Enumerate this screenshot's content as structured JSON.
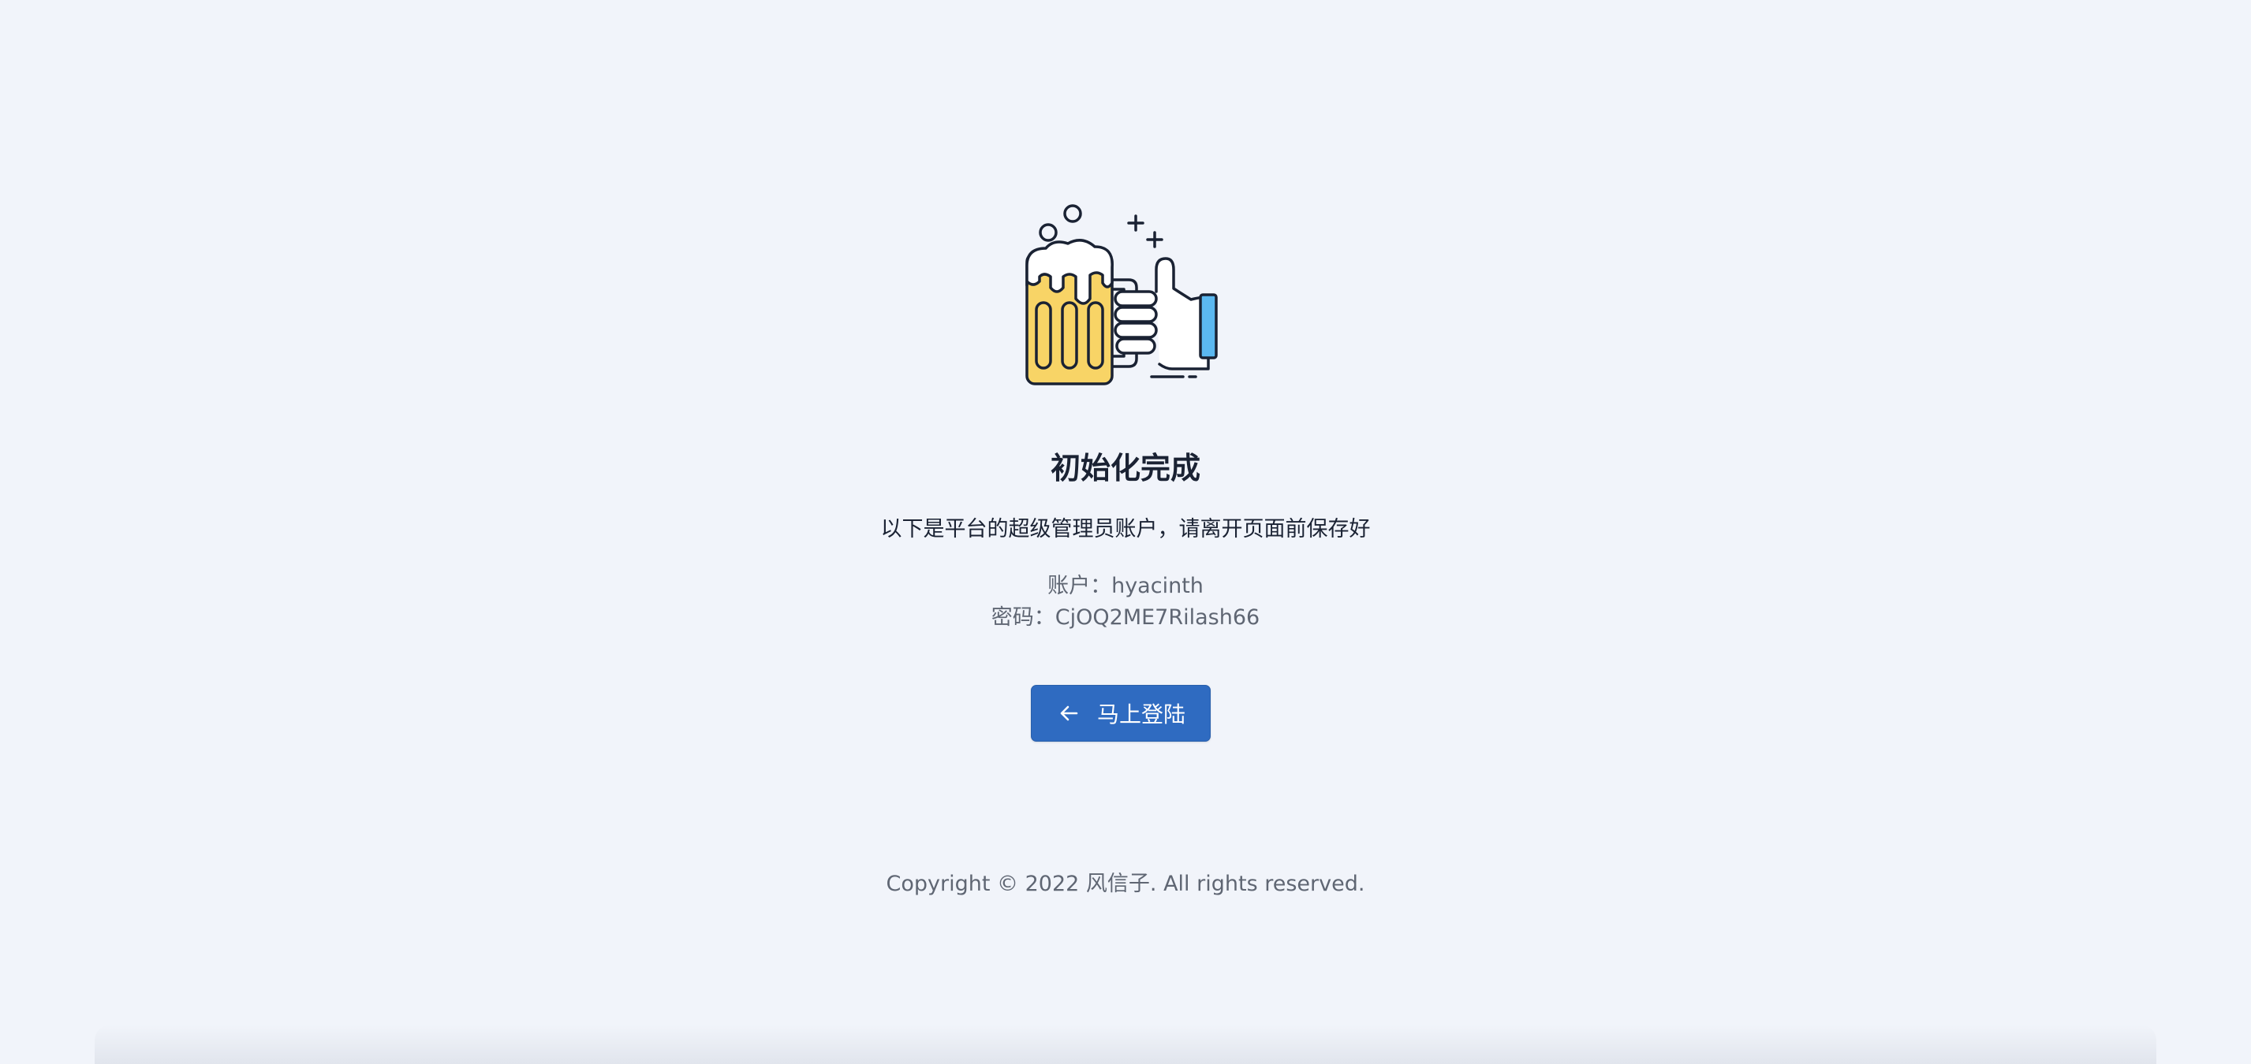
{
  "page": {
    "title": "初始化完成",
    "subtitle": "以下是平台的超级管理员账户，请离开页面前保存好"
  },
  "credentials": {
    "account_label": "账户：",
    "account_value": "hyacinth",
    "password_label": "密码：",
    "password_value": "CjOQ2ME7Rilash66"
  },
  "login_button": {
    "label": "马上登陆",
    "icon": "arrow-left-icon"
  },
  "illustration": {
    "icon": "beer-thumbs-up-illustration"
  },
  "footer": {
    "copyright": "Copyright © 2022 风信子. All rights reserved."
  },
  "colors": {
    "background": "#f1f4fa",
    "primary": "#2f6bc1",
    "beer": "#f8d466",
    "cuff": "#5bb8f0",
    "text": "#1a2233",
    "muted": "#5f6673"
  }
}
